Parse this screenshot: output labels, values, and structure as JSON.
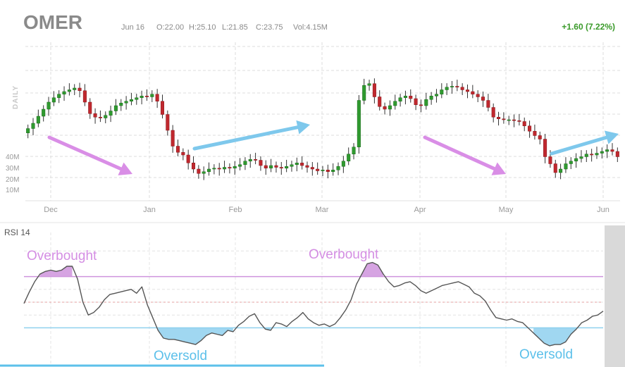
{
  "header": {
    "ticker": "OMER",
    "date": "Jun 16",
    "open": "O:22.00",
    "high": "H:25.10",
    "low": "L:21.85",
    "close": "C:23.75",
    "volume": "Vol:4.15M",
    "change": "+1.60 (7.22%)"
  },
  "colors": {
    "up": "#2f9a2f",
    "down": "#c0282e",
    "wick": "#333333",
    "arrow_down": "#d98ee6",
    "arrow_up": "#7ec8ec",
    "overbought": "#cf94dd",
    "oversold": "#8fd0ee",
    "rsi_line": "#555555",
    "grid": "#dddddd"
  },
  "chart_data": [
    {
      "type": "candlestick",
      "title": "",
      "period_label": "DAILY",
      "x_tick_labels": [
        "Dec",
        "Jan",
        "Feb",
        "Mar",
        "Apr",
        "May",
        "Jun"
      ],
      "volume_axis_labels": [
        "40M",
        "30M",
        "20M",
        "10M"
      ],
      "series": [
        {
          "name": "",
          "close": [
            23.2,
            23.8,
            24.6,
            25.4,
            26.2,
            26.7,
            27.1,
            27.4,
            27.6,
            27.8,
            27.5,
            26.2,
            24.9,
            24.5,
            24.4,
            24.7,
            25.2,
            25.8,
            26.1,
            26.3,
            26.5,
            26.7,
            26.9,
            26.8,
            27.1,
            26.3,
            24.8,
            23.0,
            21.2,
            20.5,
            20.2,
            19.3,
            18.6,
            18.1,
            18.3,
            18.6,
            18.7,
            18.6,
            18.8,
            18.7,
            18.9,
            19.1,
            19.5,
            19.7,
            19.6,
            19.0,
            18.7,
            19.0,
            18.8,
            18.7,
            18.9,
            19.1,
            19.3,
            19.0,
            18.8,
            18.6,
            18.4,
            18.5,
            18.3,
            18.5,
            18.9,
            19.5,
            20.3,
            21.1,
            26.4,
            28.1,
            28.3,
            26.8,
            25.7,
            25.4,
            25.8,
            26.3,
            26.7,
            26.9,
            26.6,
            25.9,
            25.8,
            26.5,
            26.9,
            27.1,
            27.6,
            27.9,
            28.0,
            27.9,
            27.6,
            27.4,
            27.1,
            26.8,
            26.4,
            25.6,
            24.5,
            24.3,
            24.2,
            24.2,
            24.1,
            24.0,
            23.5,
            22.9,
            22.4,
            22.0,
            20.0,
            19.2,
            18.2,
            18.6,
            19.2,
            19.5,
            19.8,
            20.0,
            20.3,
            20.2,
            20.4,
            20.6,
            20.8,
            20.6,
            20.0
          ]
        }
      ]
    },
    {
      "type": "line",
      "title": "RSI 14",
      "series": [
        {
          "name": "RSI 14",
          "values": [
            49,
            58,
            66,
            72,
            74,
            75,
            74,
            75,
            78,
            78,
            68,
            50,
            40,
            42,
            46,
            52,
            56,
            57,
            58,
            59,
            60,
            57,
            62,
            48,
            38,
            28,
            22,
            21,
            21,
            20,
            19,
            18,
            17,
            20,
            24,
            26,
            25,
            24,
            28,
            27,
            32,
            35,
            39,
            41,
            34,
            29,
            28,
            34,
            33,
            31,
            35,
            38,
            42,
            37,
            34,
            32,
            33,
            31,
            33,
            38,
            44,
            52,
            64,
            72,
            80,
            81,
            79,
            72,
            66,
            62,
            63,
            65,
            66,
            63,
            59,
            57,
            59,
            61,
            63,
            64,
            65,
            66,
            64,
            62,
            57,
            55,
            51,
            44,
            38,
            37,
            36,
            37,
            35,
            34,
            30,
            26,
            22,
            18,
            16,
            17,
            17,
            19,
            25,
            29,
            34,
            36,
            39,
            40,
            43
          ]
        }
      ],
      "levels": {
        "overbought": 70,
        "oversold": 30
      },
      "annotations": [
        "Overbought",
        "Overbought",
        "Oversold",
        "Oversold"
      ]
    }
  ]
}
